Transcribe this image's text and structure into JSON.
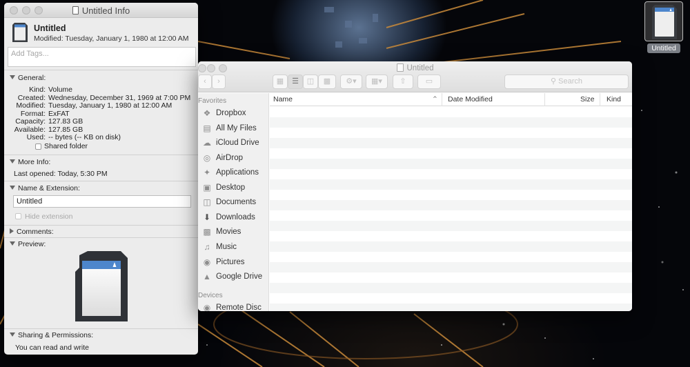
{
  "desktop": {
    "icon_label": "Untitled"
  },
  "info_window": {
    "title": "Untitled Info",
    "header_name": "Untitled",
    "header_modified": "Modified: Tuesday, January 1, 1980 at 12:00 AM",
    "tags_placeholder": "Add Tags...",
    "general": {
      "title": "General:",
      "rows": [
        {
          "key": "Kind:",
          "value": "Volume"
        },
        {
          "key": "Created:",
          "value": "Wednesday, December 31, 1969 at 7:00 PM"
        },
        {
          "key": "Modified:",
          "value": "Tuesday, January 1, 1980 at 12:00 AM"
        },
        {
          "key": "Format:",
          "value": "ExFAT"
        },
        {
          "key": "Capacity:",
          "value": "127.83 GB"
        },
        {
          "key": "Available:",
          "value": "127.85 GB"
        },
        {
          "key": "Used:",
          "value": "-- bytes (-- KB on disk)"
        }
      ],
      "shared_folder": "Shared folder"
    },
    "more_info": {
      "title": "More Info:",
      "last_opened": "Last opened: Today, 5:30 PM"
    },
    "name_extension": {
      "title": "Name & Extension:",
      "name_value": "Untitled",
      "hide_extension": "Hide extension"
    },
    "comments": {
      "title": "Comments:"
    },
    "preview": {
      "title": "Preview:"
    },
    "sharing": {
      "title": "Sharing & Permissions:",
      "text": "You can read and write"
    }
  },
  "finder": {
    "title": "Untitled",
    "search_placeholder": "Search",
    "sidebar": {
      "favorites_heading": "Favorites",
      "items": [
        {
          "label": "Dropbox",
          "icon": "dropbox-icon"
        },
        {
          "label": "All My Files",
          "icon": "all-files-icon"
        },
        {
          "label": "iCloud Drive",
          "icon": "cloud-icon"
        },
        {
          "label": "AirDrop",
          "icon": "airdrop-icon"
        },
        {
          "label": "Applications",
          "icon": "applications-icon"
        },
        {
          "label": "Desktop",
          "icon": "desktop-icon"
        },
        {
          "label": "Documents",
          "icon": "documents-icon"
        },
        {
          "label": "Downloads",
          "icon": "downloads-icon"
        },
        {
          "label": "Movies",
          "icon": "movies-icon"
        },
        {
          "label": "Music",
          "icon": "music-icon"
        },
        {
          "label": "Pictures",
          "icon": "pictures-icon"
        },
        {
          "label": "Google Drive",
          "icon": "google-drive-icon"
        }
      ],
      "devices_heading": "Devices",
      "devices": [
        {
          "label": "Remote Disc",
          "icon": "remote-disc-icon"
        }
      ]
    },
    "columns": {
      "name": "Name",
      "date_modified": "Date Modified",
      "size": "Size",
      "kind": "Kind"
    }
  }
}
